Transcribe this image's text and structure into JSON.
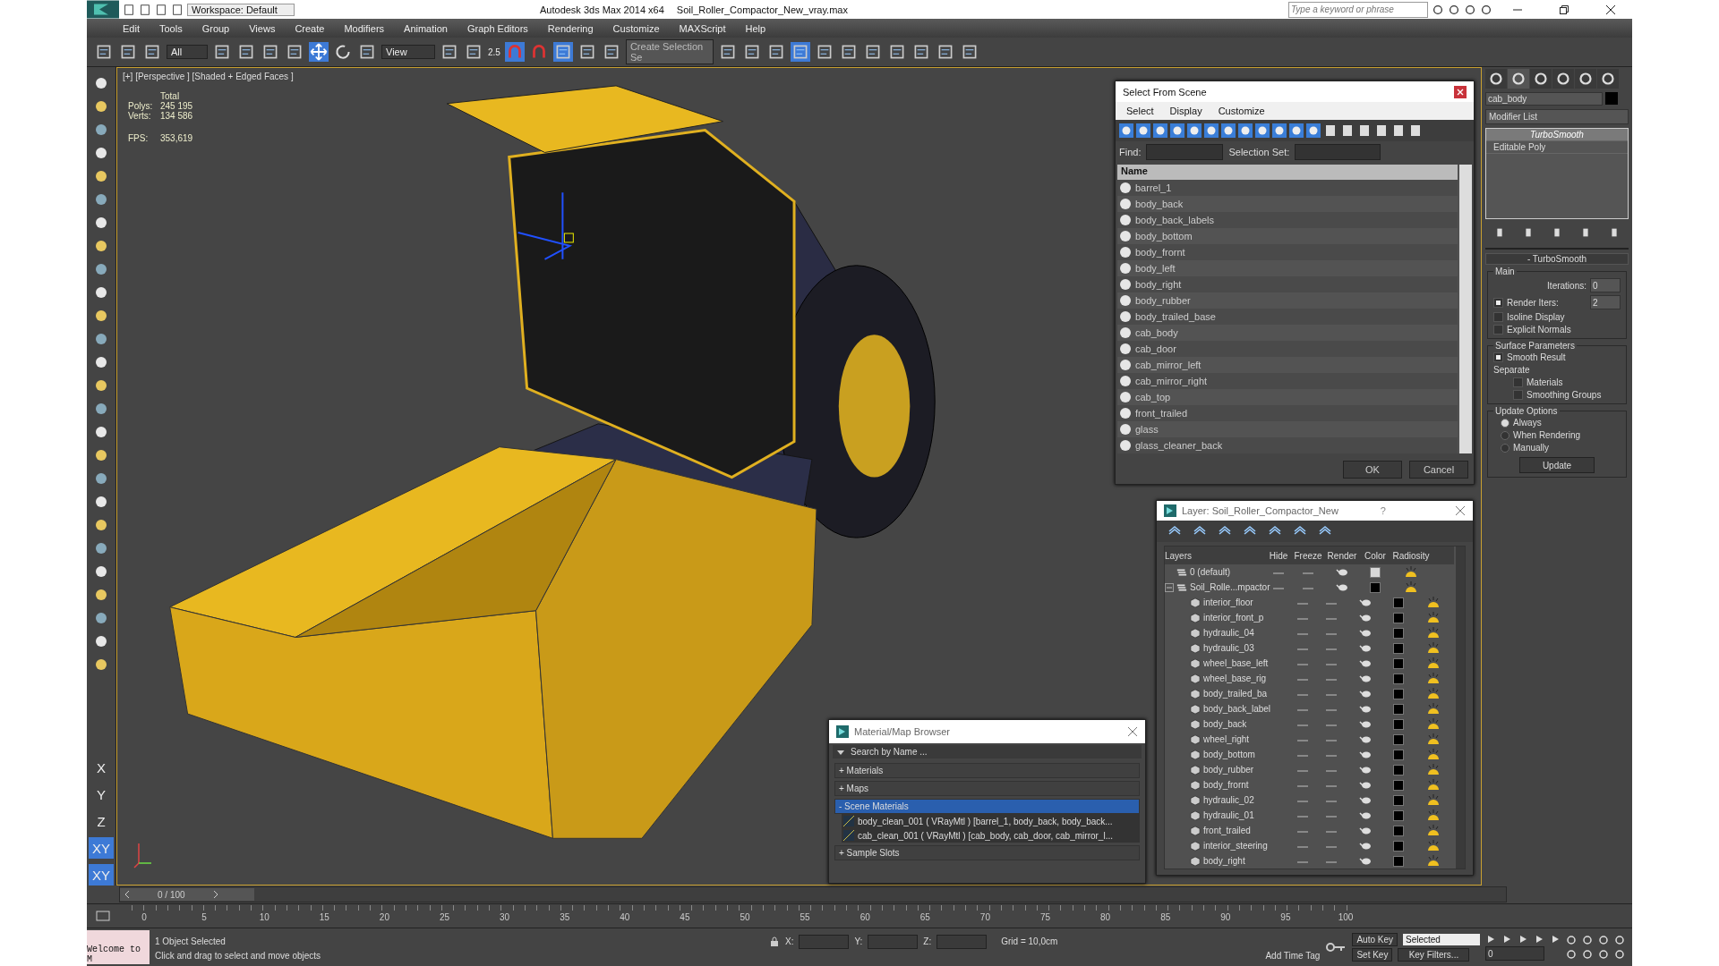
{
  "title_bar": {
    "workspace": "Workspace: Default",
    "app": "Autodesk 3ds Max  2014 x64",
    "file": "Soil_Roller_Compactor_New_vray.max",
    "search_placeholder": "Type a keyword or phrase"
  },
  "menu": [
    "Edit",
    "Tools",
    "Group",
    "Views",
    "Create",
    "Modifiers",
    "Animation",
    "Graph Editors",
    "Rendering",
    "Customize",
    "MAXScript",
    "Help"
  ],
  "toolbar": {
    "filter": "All",
    "ref_coord": "View",
    "snap_label": "2.5",
    "selection_set_placeholder": "Create Selection Se",
    "tools": [
      {
        "selected": false
      },
      {
        "selected": false
      },
      {
        "selected": false
      },
      {
        "selected": false
      },
      {
        "selected": false
      },
      {
        "selected": false
      },
      {
        "selected": false
      },
      {
        "selected": true
      },
      {
        "selected": false
      },
      {
        "selected": false
      },
      {
        "selected": false
      },
      {
        "selected": false
      },
      {
        "selected": true
      },
      {
        "selected": false
      },
      {
        "selected": true
      },
      {
        "selected": false
      },
      {
        "selected": false
      },
      {
        "selected": false
      },
      {
        "selected": false
      },
      {
        "selected": false
      },
      {
        "selected": true
      },
      {
        "selected": false
      },
      {
        "selected": false
      },
      {
        "selected": false
      },
      {
        "selected": false
      },
      {
        "selected": false
      },
      {
        "selected": false
      },
      {
        "selected": false
      }
    ]
  },
  "left_toolbar": {
    "axes": [
      {
        "label": "X",
        "selected": false
      },
      {
        "label": "Y",
        "selected": false
      },
      {
        "label": "Z",
        "selected": false
      },
      {
        "label": "XY",
        "selected": true
      },
      {
        "label": "XY",
        "selected": true
      }
    ]
  },
  "viewport": {
    "label": "[+] [Perspective ] [Shaded + Edged Faces ]",
    "stats_header": "Total",
    "stats": [
      {
        "label": "Polys:",
        "value": "245 195"
      },
      {
        "label": "Verts:",
        "value": "134 586"
      }
    ],
    "fps_label": "FPS:",
    "fps": "353,619"
  },
  "select_dialog": {
    "title": "Select From Scene",
    "menus": [
      "Select",
      "Display",
      "Customize"
    ],
    "find_label": "Find:",
    "selection_set_label": "Selection Set:",
    "column": "Name",
    "items": [
      "barrel_1",
      "body_back",
      "body_back_labels",
      "body_bottom",
      "body_frornt",
      "body_left",
      "body_right",
      "body_rubber",
      "body_trailed_base",
      "cab_body",
      "cab_door",
      "cab_mirror_left",
      "cab_mirror_right",
      "cab_top",
      "front_trailed",
      "glass",
      "glass_cleaner_back"
    ],
    "ok": "OK",
    "cancel": "Cancel"
  },
  "layer_dialog": {
    "title": "Layer: Soil_Roller_Compactor_New",
    "help": "?",
    "columns": [
      "Layers",
      "Hide",
      "Freeze",
      "Render",
      "Color",
      "Radiosity"
    ],
    "layers": [
      {
        "name": "0 (default)",
        "color": "#d8d8d8"
      },
      {
        "name": "Soil_Rolle...mpactor",
        "color": "#000000",
        "expanded": true,
        "children": [
          {
            "name": "interior_floor",
            "color": "#000000"
          },
          {
            "name": "interior_front_p",
            "color": "#000000"
          },
          {
            "name": "hydraulic_04",
            "color": "#000000"
          },
          {
            "name": "hydraulic_03",
            "color": "#000000"
          },
          {
            "name": "wheel_base_left",
            "color": "#000000"
          },
          {
            "name": "wheel_base_rig",
            "color": "#000000"
          },
          {
            "name": "body_trailed_ba",
            "color": "#000000"
          },
          {
            "name": "body_back_label",
            "color": "#000000"
          },
          {
            "name": "body_back",
            "color": "#000000"
          },
          {
            "name": "wheel_right",
            "color": "#000000"
          },
          {
            "name": "body_bottom",
            "color": "#000000"
          },
          {
            "name": "body_rubber",
            "color": "#000000"
          },
          {
            "name": "body_frornt",
            "color": "#000000"
          },
          {
            "name": "hydraulic_02",
            "color": "#000000"
          },
          {
            "name": "hydraulic_01",
            "color": "#000000"
          },
          {
            "name": "front_trailed",
            "color": "#000000"
          },
          {
            "name": "interior_steering",
            "color": "#000000"
          },
          {
            "name": "body_right",
            "color": "#000000"
          }
        ]
      }
    ]
  },
  "material_browser": {
    "title": "Material/Map Browser",
    "search_placeholder": "Search by Name ...",
    "groups": [
      {
        "sign": "+",
        "label": "Materials",
        "expanded": false
      },
      {
        "sign": "+",
        "label": "Maps",
        "expanded": false
      },
      {
        "sign": "-",
        "label": "Scene Materials",
        "expanded": true,
        "items": [
          "body_clean_001 ( VRayMtl ) [barrel_1, body_back, body_back...",
          "cab_clean_001 ( VRayMtl ) [cab_body, cab_door, cab_mirror_l..."
        ]
      },
      {
        "sign": "+",
        "label": "Sample Slots",
        "expanded": false
      }
    ]
  },
  "command_panel": {
    "tabs": [
      {
        "selected": false
      },
      {
        "selected": true
      },
      {
        "selected": false
      },
      {
        "selected": false
      },
      {
        "selected": false
      },
      {
        "selected": false
      }
    ],
    "object_name": "cab_body",
    "modifier_list": "Modifier List",
    "stack": [
      {
        "name": "TurboSmooth",
        "kind": "modifier",
        "selected": true
      },
      {
        "name": "Editable Poly",
        "kind": "base",
        "selected": false
      }
    ],
    "rollout": {
      "sign": "-",
      "title": "TurboSmooth",
      "main_title": "Main",
      "iterations_label": "Iterations:",
      "iterations": "0",
      "render_iters_label": "Render Iters:",
      "render_iters": "2",
      "render_iters_checked": true,
      "main_options": [
        {
          "label": "Isoline Display",
          "checked": false
        },
        {
          "label": "Explicit Normals",
          "checked": false
        }
      ],
      "surface_title": "Surface Parameters",
      "smooth_result": {
        "label": "Smooth Result",
        "checked": true
      },
      "separate_label": "Separate",
      "separate": [
        {
          "label": "Materials",
          "checked": false
        },
        {
          "label": "Smoothing Groups",
          "checked": false
        }
      ],
      "update_title": "Update Options",
      "update_options": [
        {
          "label": "Always",
          "selected": true
        },
        {
          "label": "When Rendering",
          "selected": false
        },
        {
          "label": "Manually",
          "selected": false
        }
      ],
      "update_button": "Update"
    }
  },
  "timeline": {
    "frame": "0 / 100",
    "level": 0,
    "ticks": [
      "0",
      "5",
      "10",
      "15",
      "20",
      "25",
      "30",
      "35",
      "40",
      "45",
      "50",
      "55",
      "60",
      "65",
      "70",
      "75",
      "80",
      "85",
      "90",
      "95",
      "100"
    ]
  },
  "status": {
    "maxscript": "Welcome to M",
    "selected": "1 Object Selected",
    "prompt": "Click and drag to select and move objects",
    "x_label": "X:",
    "y_label": "Y:",
    "z_label": "Z:",
    "grid": "Grid = 10,0cm",
    "add_time_tag": "Add Time Tag",
    "auto_key": "Auto Key",
    "set_key": "Set Key",
    "key_mode": "Selected",
    "key_filters": "Key Filters...",
    "frame": "0"
  }
}
